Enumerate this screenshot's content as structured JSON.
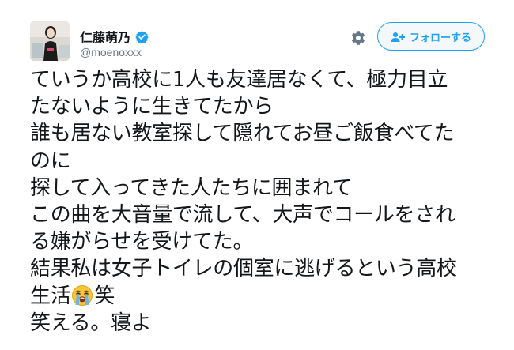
{
  "user": {
    "display_name": "仁藤萌乃",
    "handle": "@moenoxxx",
    "verified": true,
    "avatar_icon": "profile-photo"
  },
  "actions": {
    "settings_icon": "gear-icon",
    "follow_label": "フォローする",
    "follow_icon": "add-user-icon"
  },
  "tweet": {
    "lines": [
      "ていうか高校に1人も友達居なくて、極力目立",
      "たないように生きてたから",
      "誰も居ない教室探して隠れてお昼ご飯食べてた",
      "のに",
      "探して入ってきた人たちに囲まれて",
      "この曲を大音量で流して、大声でコールをされ",
      "る嫌がらせを受けてた。",
      "結果私は女子トイレの個室に逃げるという高校",
      "生活",
      "笑",
      "笑える。寝よ"
    ],
    "emoji": "loudly-crying-face-icon"
  },
  "colors": {
    "accent": "#1da1f2",
    "text": "#14171a",
    "secondary": "#657786"
  }
}
